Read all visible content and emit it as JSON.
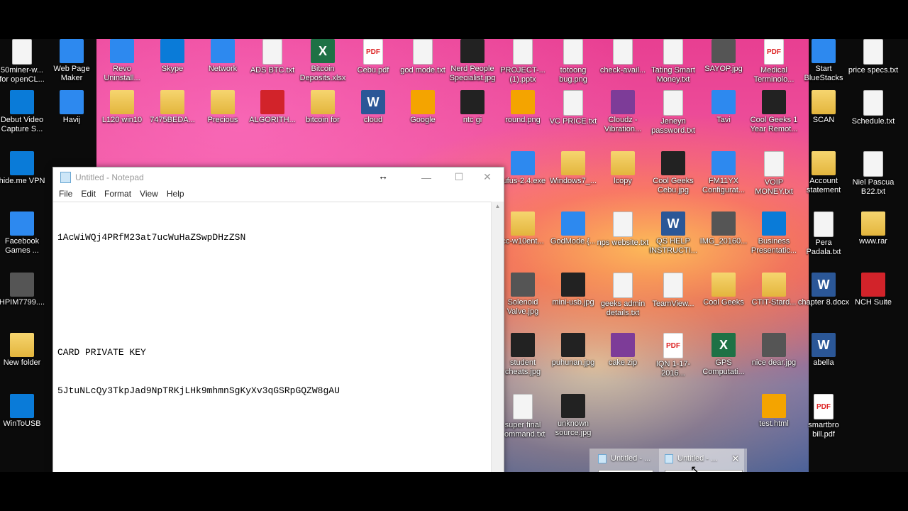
{
  "desktop_icons": [
    {
      "label": "50miner-w... for openCL...",
      "glyph": "txt",
      "col": 0,
      "row": 0
    },
    {
      "label": "Web Page Maker",
      "glyph": "app",
      "col": 1,
      "row": 0
    },
    {
      "label": "Revo Uninstall...",
      "glyph": "app",
      "col": 2,
      "row": 0
    },
    {
      "label": "Skype",
      "glyph": "blue",
      "col": 3,
      "row": 0
    },
    {
      "label": "Network",
      "glyph": "app",
      "col": 4,
      "row": 0
    },
    {
      "label": "ADS BTC.txt",
      "glyph": "txt",
      "col": 5,
      "row": 0
    },
    {
      "label": "Bitcoin Deposits.xlsx",
      "glyph": "excel",
      "col": 6,
      "row": 0
    },
    {
      "label": "Cebu.pdf",
      "glyph": "pdf",
      "col": 7,
      "row": 0
    },
    {
      "label": "god mode.txt",
      "glyph": "txt",
      "col": 8,
      "row": 0
    },
    {
      "label": "Nerd People Specialist.jpg",
      "glyph": "dark",
      "col": 9,
      "row": 0
    },
    {
      "label": "PROJECT-... (1).pptx",
      "glyph": "txt",
      "col": 10,
      "row": 0
    },
    {
      "label": "totoong bug.png",
      "glyph": "txt",
      "col": 11,
      "row": 0
    },
    {
      "label": "check-avail...",
      "glyph": "txt",
      "col": 12,
      "row": 0
    },
    {
      "label": "Tating Smart Money.txt",
      "glyph": "txt",
      "col": 13,
      "row": 0
    },
    {
      "label": "SAYOP.jpg",
      "glyph": "img",
      "col": 14,
      "row": 0
    },
    {
      "label": "Medical Terminolo...",
      "glyph": "pdf",
      "col": 15,
      "row": 0
    },
    {
      "label": "Start BlueStacks",
      "glyph": "app",
      "col": 16,
      "row": 0
    },
    {
      "label": "price specs.txt",
      "glyph": "txt",
      "col": 17,
      "row": 0
    },
    {
      "label": "Debut Video Capture S...",
      "glyph": "blue",
      "col": 0,
      "row": 1
    },
    {
      "label": "Havij",
      "glyph": "app",
      "col": 1,
      "row": 1
    },
    {
      "label": "L120 win10",
      "glyph": "folder",
      "col": 2,
      "row": 1
    },
    {
      "label": "7475BEDA...",
      "glyph": "folder",
      "col": 3,
      "row": 1
    },
    {
      "label": "Precious",
      "glyph": "folder",
      "col": 4,
      "row": 1
    },
    {
      "label": "ALGORITH...",
      "glyph": "red",
      "col": 5,
      "row": 1
    },
    {
      "label": "bitcoin for",
      "glyph": "folder",
      "col": 6,
      "row": 1
    },
    {
      "label": "cloud",
      "glyph": "word",
      "col": 7,
      "row": 1
    },
    {
      "label": "Google",
      "glyph": "browser",
      "col": 8,
      "row": 1
    },
    {
      "label": "ntc gi",
      "glyph": "dark",
      "col": 9,
      "row": 1
    },
    {
      "label": "round.png",
      "glyph": "browser",
      "col": 10,
      "row": 1
    },
    {
      "label": "VC PRICE.txt",
      "glyph": "txt",
      "col": 11,
      "row": 1
    },
    {
      "label": "Cloudz - Vibration...",
      "glyph": "zip",
      "col": 12,
      "row": 1
    },
    {
      "label": "Jeneyn password.txt",
      "glyph": "txt",
      "col": 13,
      "row": 1
    },
    {
      "label": "Tavi",
      "glyph": "app",
      "col": 14,
      "row": 1
    },
    {
      "label": "Cool Geeks 1 Year Remot...",
      "glyph": "dark",
      "col": 15,
      "row": 1
    },
    {
      "label": "SCAN",
      "glyph": "folder",
      "col": 16,
      "row": 1
    },
    {
      "label": "Schedule.txt",
      "glyph": "txt",
      "col": 17,
      "row": 1
    },
    {
      "label": "hide.me VPN",
      "glyph": "blue",
      "col": 0,
      "row": 2
    },
    {
      "label": "rufus-2.4.exe",
      "glyph": "app",
      "col": 10,
      "row": 2
    },
    {
      "label": "Windows7_...",
      "glyph": "folder",
      "col": 11,
      "row": 2
    },
    {
      "label": "lcopy",
      "glyph": "folder",
      "col": 12,
      "row": 2
    },
    {
      "label": "Cool Geeks Cebu.jpg",
      "glyph": "dark",
      "col": 13,
      "row": 2
    },
    {
      "label": "FM11YX Configurat...",
      "glyph": "app",
      "col": 14,
      "row": 2
    },
    {
      "label": "VOIP MONEY.txt",
      "glyph": "txt",
      "col": 15,
      "row": 2
    },
    {
      "label": "Account statement",
      "glyph": "folder",
      "col": 16,
      "row": 2
    },
    {
      "label": "Niel Pascua B22.txt",
      "glyph": "txt",
      "col": 17,
      "row": 2
    },
    {
      "label": "Facebook Games ...",
      "glyph": "app",
      "col": 0,
      "row": 3
    },
    {
      "label": "cc-w10ent...",
      "glyph": "folder",
      "col": 10,
      "row": 3
    },
    {
      "label": "GodMode.{...",
      "glyph": "app",
      "col": 11,
      "row": 3
    },
    {
      "label": "nps website.txt",
      "glyph": "txt",
      "col": 12,
      "row": 3
    },
    {
      "label": "QS HELP INSTRUCTI...",
      "glyph": "word",
      "col": 13,
      "row": 3
    },
    {
      "label": "IMG_20160...",
      "glyph": "img",
      "col": 14,
      "row": 3
    },
    {
      "label": "Business Presentatic...",
      "glyph": "blue",
      "col": 15,
      "row": 3
    },
    {
      "label": "Pera Padala.txt",
      "glyph": "txt",
      "col": 16,
      "row": 3
    },
    {
      "label": "www.rar",
      "glyph": "folder",
      "col": 17,
      "row": 3
    },
    {
      "label": "HPIM7799....",
      "glyph": "img",
      "col": 0,
      "row": 4
    },
    {
      "label": "Solenoid Valve.jpg",
      "glyph": "img",
      "col": 10,
      "row": 4
    },
    {
      "label": "mini-usb.jpg",
      "glyph": "dark",
      "col": 11,
      "row": 4
    },
    {
      "label": "geeks admin details.txt",
      "glyph": "txt",
      "col": 12,
      "row": 4
    },
    {
      "label": "TeamView...",
      "glyph": "txt",
      "col": 13,
      "row": 4
    },
    {
      "label": "Cool Geeks",
      "glyph": "folder",
      "col": 14,
      "row": 4
    },
    {
      "label": "CTIT-Stard...",
      "glyph": "folder",
      "col": 15,
      "row": 4
    },
    {
      "label": "chapter 8.docx",
      "glyph": "word",
      "col": 16,
      "row": 4
    },
    {
      "label": "NCH Suite",
      "glyph": "red",
      "col": 17,
      "row": 4
    },
    {
      "label": "New folder",
      "glyph": "folder",
      "col": 0,
      "row": 5
    },
    {
      "label": "student cheats.jpg",
      "glyph": "dark",
      "col": 10,
      "row": 5
    },
    {
      "label": "puhunan.jpg",
      "glyph": "dark",
      "col": 11,
      "row": 5
    },
    {
      "label": "cake.zip",
      "glyph": "zip",
      "col": 12,
      "row": 5
    },
    {
      "label": "IQN 1-17-2016...",
      "glyph": "pdf",
      "col": 13,
      "row": 5
    },
    {
      "label": "GPS Computati...",
      "glyph": "excel",
      "col": 14,
      "row": 5
    },
    {
      "label": "nice dear.jpg",
      "glyph": "img",
      "col": 15,
      "row": 5
    },
    {
      "label": "abella",
      "glyph": "word",
      "col": 16,
      "row": 5
    },
    {
      "label": "WinToUSB",
      "glyph": "blue",
      "col": 0,
      "row": 6
    },
    {
      "label": "super final command.txt",
      "glyph": "txt",
      "col": 10,
      "row": 6
    },
    {
      "label": "unknown source.jpg",
      "glyph": "dark",
      "col": 11,
      "row": 6
    },
    {
      "label": "test.html",
      "glyph": "browser",
      "col": 15,
      "row": 6
    },
    {
      "label": "smartbro bill.pdf",
      "glyph": "pdf",
      "col": 16,
      "row": 6
    }
  ],
  "notepad": {
    "title": "Untitled - Notepad",
    "menu": [
      "File",
      "Edit",
      "Format",
      "View",
      "Help"
    ],
    "content_lines": [
      "1AcWiWQj4PRfM23at7ucWuHaZSwpDHzZSN",
      "",
      "",
      "CARD PRIVATE KEY",
      "5JtuNLcQy3TkpJad9NpTRKjLHk9mhmnSgKyXv3qGSRpGQZW8gAU"
    ],
    "buttons": {
      "minimize": "—",
      "maximize": "☐",
      "close": "✕"
    }
  },
  "taskbar_preview": {
    "items": [
      {
        "title": "Untitled - ..."
      },
      {
        "title": "Untitled - ..."
      }
    ],
    "close_glyph": "✕"
  },
  "glyph_text": {
    "txt": "",
    "folder": "",
    "pdf": "PDF",
    "word": "W",
    "excel": "X",
    "img": "",
    "app": "",
    "red": "",
    "zip": "",
    "browser": "",
    "dark": "",
    "blue": ""
  }
}
